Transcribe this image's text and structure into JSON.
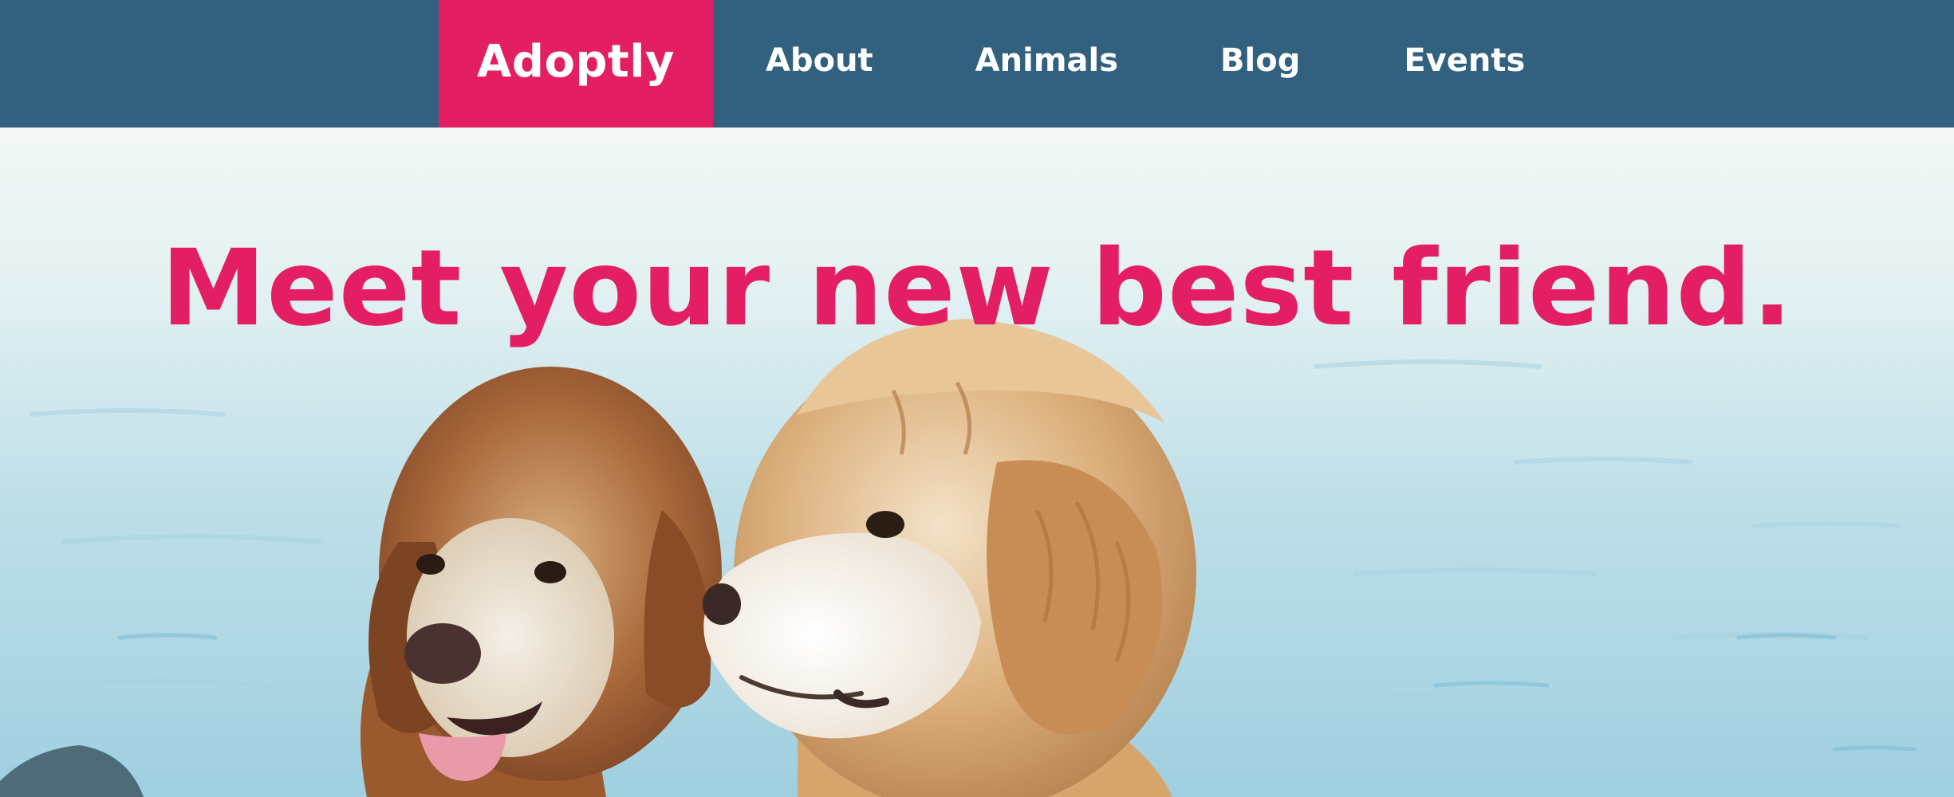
{
  "nav": {
    "brand": "Adoptly",
    "links": [
      {
        "label": "About"
      },
      {
        "label": "Animals"
      },
      {
        "label": "Blog"
      },
      {
        "label": "Events"
      }
    ]
  },
  "hero": {
    "headline": "Meet your new best friend.",
    "image": "two-golden-retrievers-by-water"
  },
  "colors": {
    "nav_background": "#31617f",
    "brand_accent": "#e31e63",
    "headline": "#e31e63",
    "nav_text": "#ffffff"
  }
}
